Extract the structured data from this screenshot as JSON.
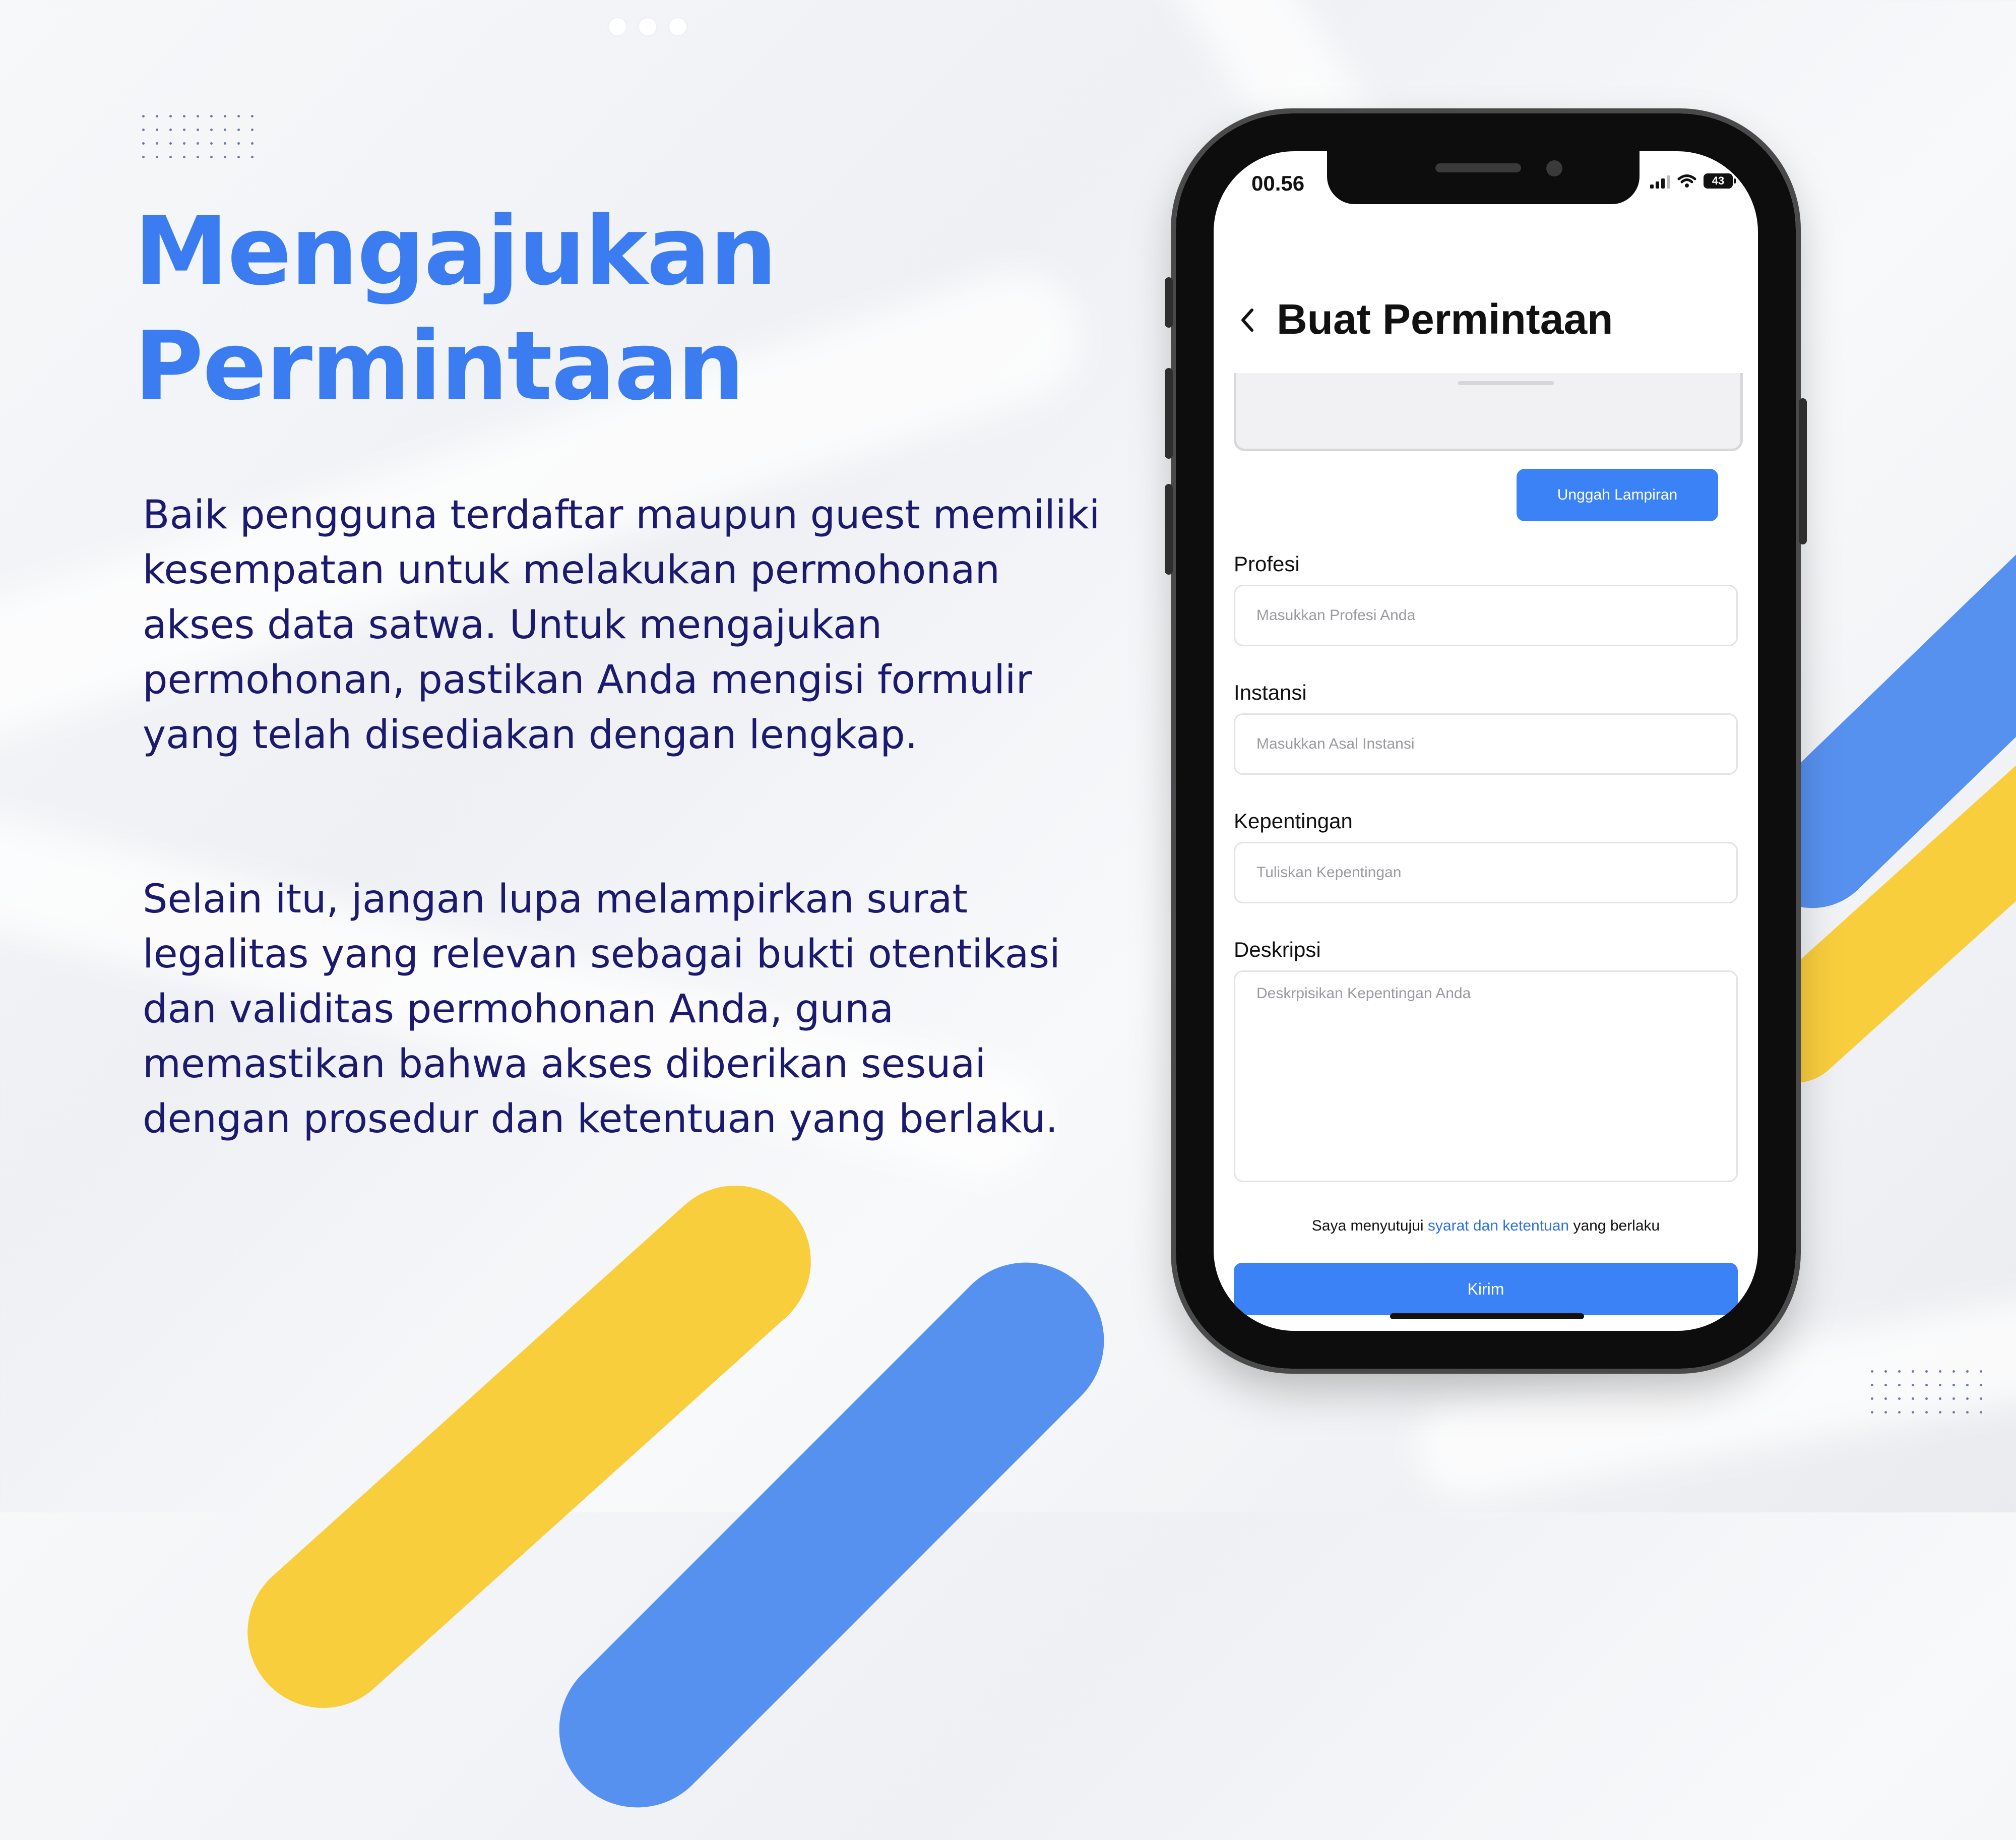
{
  "headline": {
    "line1": "Mengajukan",
    "line2": "Permintaan"
  },
  "description": {
    "paragraph1": "Baik pengguna terdaftar maupun guest memiliki kesempatan untuk melakukan permohonan akses data satwa. Untuk mengajukan permohonan, pastikan Anda mengisi formulir yang telah disediakan dengan lengkap.",
    "paragraph2": "Selain itu, jangan lupa melampirkan surat legalitas yang relevan sebagai bukti otentikasi dan validitas permohonan Anda, guna memastikan bahwa akses diberikan sesuai dengan prosedur dan ketentuan yang berlaku."
  },
  "colors": {
    "accent_blue": "#3b82f6",
    "headline_blue": "#3b7df0",
    "body_navy": "#1b1a6e",
    "accent_yellow": "#f9ce3d"
  },
  "phone": {
    "status_bar": {
      "time": "00.56",
      "battery": "43",
      "icons": [
        "signal-icon",
        "wifi-icon",
        "battery-icon"
      ]
    },
    "header": {
      "back_icon": "chevron-left-icon",
      "title": "Buat Permintaan"
    },
    "form": {
      "upload_button": "Unggah Lampiran",
      "profesi": {
        "label": "Profesi",
        "placeholder": "Masukkan Profesi Anda",
        "value": ""
      },
      "instansi": {
        "label": "Instansi",
        "placeholder": "Masukkan Asal Instansi",
        "value": ""
      },
      "kepentingan": {
        "label": "Kepentingan",
        "placeholder": "Tuliskan Kepentingan",
        "value": ""
      },
      "deskripsi": {
        "label": "Deskripsi",
        "placeholder": "Deskrpisikan Kepentingan Anda",
        "value": ""
      },
      "terms": {
        "prefix": "Saya menyutujui",
        "link": "syarat dan ketentuan",
        "suffix": "yang berlaku"
      },
      "submit_button": "Kirim"
    }
  }
}
